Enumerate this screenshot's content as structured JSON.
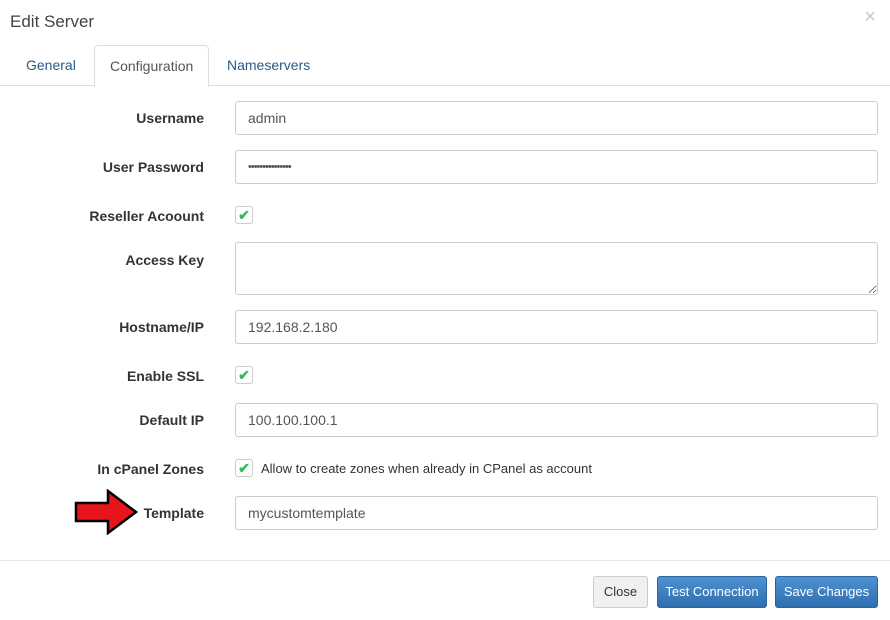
{
  "dialog": {
    "title": "Edit Server",
    "close_icon": "×"
  },
  "tabs": [
    {
      "label": "General"
    },
    {
      "label": "Configuration",
      "active": true
    },
    {
      "label": "Nameservers"
    }
  ],
  "form": {
    "username": {
      "label": "Username",
      "value": "admin"
    },
    "password": {
      "label": "User Password",
      "value": "•••••••••••••••"
    },
    "reseller": {
      "label": "Reseller Acoount",
      "checked": true
    },
    "access_key": {
      "label": "Access Key",
      "value": ""
    },
    "hostname": {
      "label": "Hostname/IP",
      "value": "192.168.2.180"
    },
    "ssl": {
      "label": "Enable SSL",
      "checked": true
    },
    "default_ip": {
      "label": "Default IP",
      "value": "100.100.100.1"
    },
    "cpanel_zones": {
      "label": "In cPanel Zones",
      "checked": true,
      "text": "Allow to create zones when already in CPanel as account"
    },
    "template": {
      "label": "Template",
      "value": "mycustomtemplate"
    }
  },
  "buttons": {
    "close": "Close",
    "test": "Test Connection",
    "save": "Save Changes"
  },
  "colors": {
    "primary": "#337ab7",
    "check": "#2ebd59",
    "arrow": "#e8141c"
  },
  "checkmark": "✔"
}
